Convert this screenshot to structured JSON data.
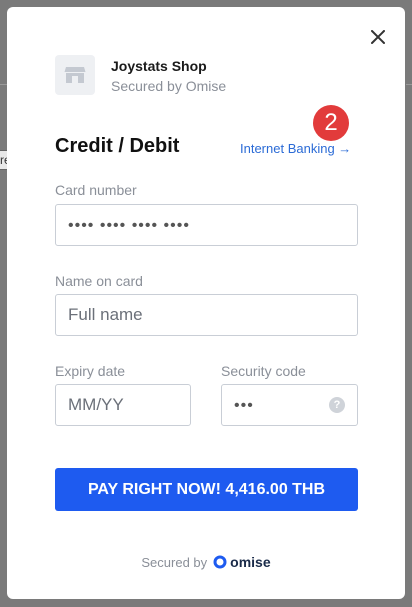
{
  "background": {
    "fragment_text": "re"
  },
  "modal": {
    "close_label": "×",
    "merchant": {
      "name": "Joystats Shop",
      "secured_by": "Secured by Omise",
      "logo_icon": "store-icon"
    },
    "title": "Credit / Debit",
    "alt_method_link": "Internet Banking →",
    "badge": "2",
    "fields": {
      "card_number": {
        "label": "Card number",
        "placeholder": "•••• •••• •••• ••••"
      },
      "name_on_card": {
        "label": "Name on card",
        "placeholder": "Full name"
      },
      "expiry": {
        "label": "Expiry date",
        "placeholder": "MM/YY"
      },
      "security_code": {
        "label": "Security code",
        "placeholder": "•••",
        "help_icon": "question-icon",
        "help_label": "?"
      }
    },
    "pay_button": "PAY RIGHT NOW! 4,416.00 THB",
    "footer": {
      "secured_by": "Secured by",
      "brand": "omise"
    }
  },
  "colors": {
    "accent": "#1e5bf0",
    "link": "#2b6bd6",
    "badge": "#e23b3b",
    "overlay": "#7a7a7a"
  }
}
